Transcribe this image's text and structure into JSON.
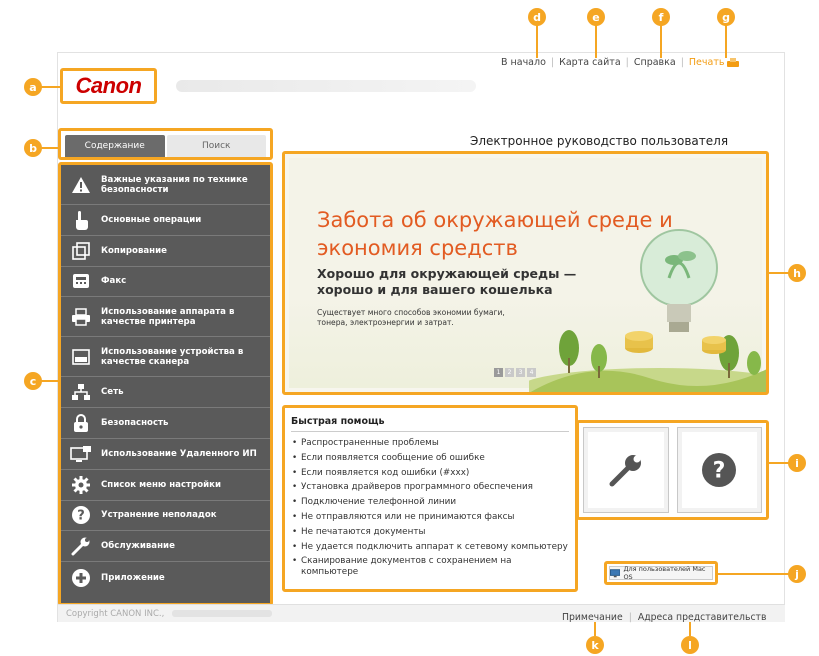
{
  "header": {
    "logo_text": "Canon",
    "links": {
      "home": "В начало",
      "sitemap": "Карта сайта",
      "help": "Справка",
      "print": "Печать"
    }
  },
  "tabs": {
    "contents": "Содержание",
    "search": "Поиск"
  },
  "sidebar": {
    "items": [
      {
        "label": "Важные указания по технике безопасности",
        "icon": "warning-icon"
      },
      {
        "label": "Основные операции",
        "icon": "hand-icon"
      },
      {
        "label": "Копирование",
        "icon": "copy-icon"
      },
      {
        "label": "Факс",
        "icon": "fax-icon"
      },
      {
        "label": "Использование аппарата в качестве принтера",
        "icon": "printer-icon"
      },
      {
        "label": "Использование устройства в качестве сканера",
        "icon": "scanner-icon"
      },
      {
        "label": "Сеть",
        "icon": "network-icon"
      },
      {
        "label": "Безопасность",
        "icon": "lock-icon"
      },
      {
        "label": "Использование Удаленного ИП",
        "icon": "remote-ui-icon"
      },
      {
        "label": "Список меню настройки",
        "icon": "gear-icon"
      },
      {
        "label": "Устранение неполадок",
        "icon": "question-icon"
      },
      {
        "label": "Обслуживание",
        "icon": "wrench-icon"
      },
      {
        "label": "Приложение",
        "icon": "plus-icon"
      }
    ]
  },
  "main": {
    "guide_title": "Электронное руководство пользователя",
    "banner": {
      "headline": "Забота об окружающей среде и экономия средств",
      "subheadline": "Хорошо для окружающей среды — хорошо и для вашего кошелька",
      "text": "Существует много способов экономии бумаги, тонера, электроэнергии и затрат.",
      "pages": [
        "1",
        "2",
        "3",
        "4"
      ],
      "active_page": 1
    },
    "quick_help": {
      "title": "Быстрая помощь",
      "items": [
        "Распространенные проблемы",
        "Если появляется сообщение об ошибке",
        "Если появляется код ошибки (#xxx)",
        "Установка драйверов программного обеспечения",
        "Подключение телефонной линии",
        "Не отправляются или не принимаются факсы",
        "Не печатаются документы",
        "Не удается подключить аппарат к сетевому компьютеру",
        "Сканирование документов с сохранением на компьютере"
      ]
    },
    "mac_button": "Для пользователей Mac OS"
  },
  "footer": {
    "copyright": "Copyright CANON INC.,",
    "notes": "Примечание",
    "addresses": "Адреса представительств"
  },
  "callouts": {
    "a": "a",
    "b": "b",
    "c": "c",
    "d": "d",
    "e": "e",
    "f": "f",
    "g": "g",
    "h": "h",
    "i": "i",
    "j": "j",
    "k": "k",
    "l": "l"
  },
  "colors": {
    "accent": "#f5a623",
    "brand_red": "#cc0000",
    "headline_orange": "#e25b22",
    "sidebar_bg": "#5a5a5a"
  }
}
